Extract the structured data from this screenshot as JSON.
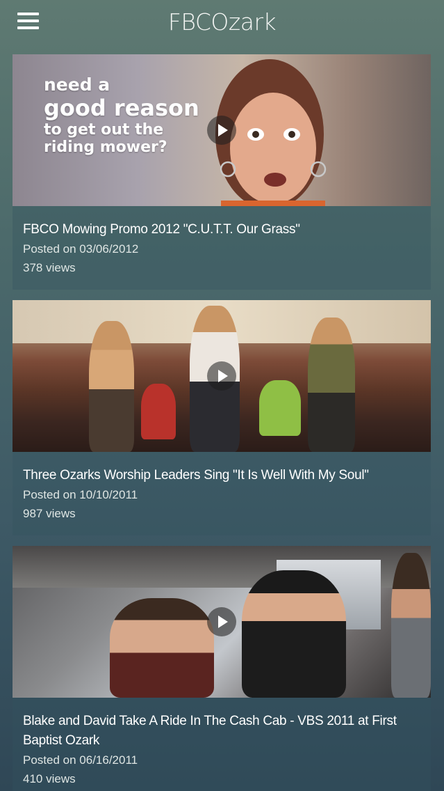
{
  "app": {
    "title": "FBCOzark"
  },
  "icons": {
    "menu": "hamburger-menu-icon",
    "play": "play-icon"
  },
  "videos": [
    {
      "title": "FBCO Mowing Promo 2012 \"C.U.T.T. Our Grass\"",
      "posted": "Posted on 03/06/2012",
      "views": "378 views",
      "thumbnail_text": [
        "need a",
        "good reason",
        "to get out the",
        "riding mower?"
      ]
    },
    {
      "title": "Three Ozarks Worship Leaders Sing \"It Is Well With My Soul\"",
      "posted": "Posted on 10/10/2011",
      "views": "987 views"
    },
    {
      "title": "Blake and David Take A Ride In The Cash Cab - VBS 2011 at First Baptist Ozark",
      "posted": "Posted on 06/16/2011",
      "views": "410 views"
    }
  ]
}
